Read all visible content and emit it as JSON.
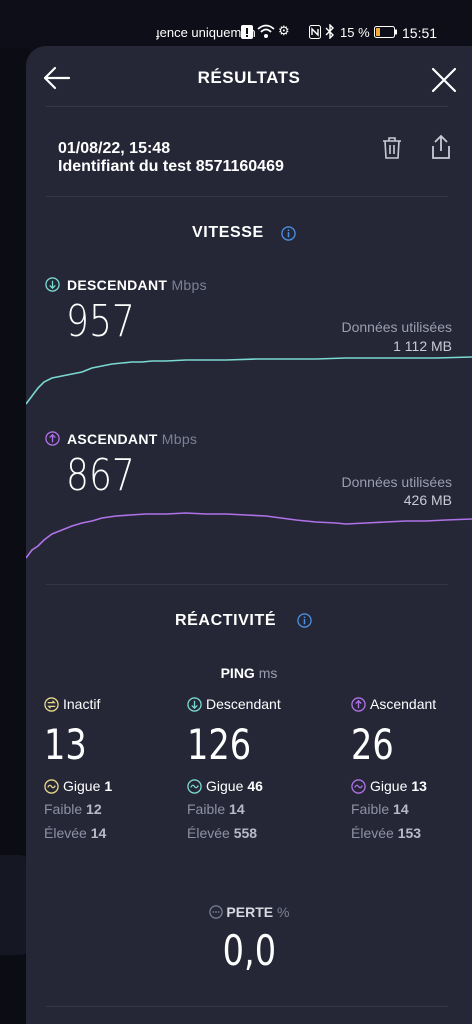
{
  "status_bar": {
    "notification_text": "ɟence uniquemen",
    "battery": "15 %",
    "time": "15:51"
  },
  "header": {
    "title": "RÉSULTATS"
  },
  "test": {
    "date": "01/08/22, 15:48",
    "id_text": "Identifiant du test 8571160469"
  },
  "speed": {
    "title": "VITESSE",
    "download": {
      "label": "DESCENDANT",
      "unit": "Mbps",
      "value": "957",
      "data_used_label": "Données utilisées",
      "data_used_value": "1 112 MB",
      "color": "#7ad9d0"
    },
    "upload": {
      "label": "ASCENDANT",
      "unit": "Mbps",
      "value": "867",
      "data_used_label": "Données utilisées",
      "data_used_value": "426 MB",
      "color": "#b072e8"
    }
  },
  "responsiveness": {
    "title": "RÉACTIVITÉ",
    "ping_label": "PING",
    "ping_unit": "ms",
    "columns": [
      {
        "label": "Inactif",
        "value": "13",
        "jitter_label": "Gigue",
        "jitter": "1",
        "low_label": "Faible",
        "low": "12",
        "high_label": "Élevée",
        "high": "14",
        "color": "#e8d98a"
      },
      {
        "label": "Descendant",
        "value": "126",
        "jitter_label": "Gigue",
        "jitter": "46",
        "low_label": "Faible",
        "low": "14",
        "high_label": "Élevée",
        "high": "558",
        "color": "#7ad9d0"
      },
      {
        "label": "Ascendant",
        "value": "26",
        "jitter_label": "Gigue",
        "jitter": "13",
        "low_label": "Faible",
        "low": "14",
        "high_label": "Élevée",
        "high": "153",
        "color": "#b072e8"
      }
    ]
  },
  "loss": {
    "label": "PERTE",
    "unit": "%",
    "value": "0,0"
  },
  "colors": {
    "sheet_bg": "#252736",
    "info_blue": "#4a90e2"
  }
}
